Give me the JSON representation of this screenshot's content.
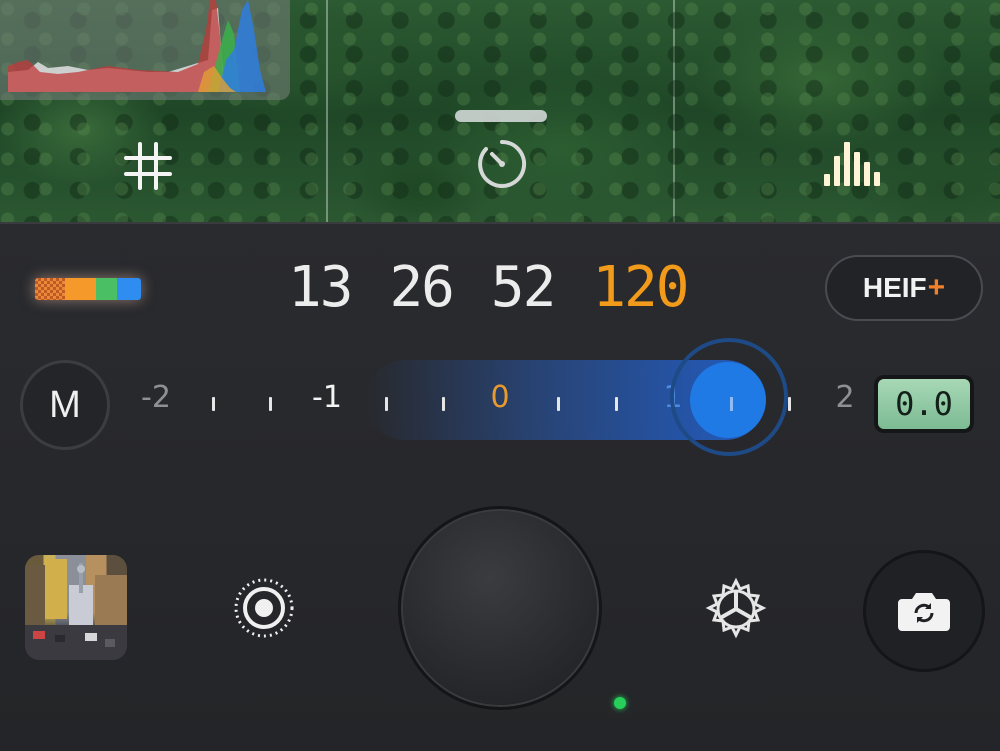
{
  "frame_rates": {
    "options": [
      "13",
      "26",
      "52",
      "120"
    ],
    "selected": "120"
  },
  "format_button": {
    "label": "HEIF",
    "plus": "+"
  },
  "mode_button": {
    "label": "M"
  },
  "exposure": {
    "scale_labels": [
      "-2",
      "-1",
      "0",
      "1",
      "2"
    ],
    "value": "0.0",
    "slider_position_ev": 1.0
  },
  "colors": {
    "accent_orange": "#f29a1a",
    "slider_blue": "#1f7ae6",
    "ev_display_green": "#9fd2ad",
    "indicator_green": "#26d05a"
  },
  "icons": {
    "viewfinder": [
      "grid-icon",
      "timer-icon",
      "histogram-toggle-icon"
    ],
    "bottom": [
      "live-photo-icon",
      "settings-gear-icon",
      "flip-camera-icon"
    ]
  }
}
